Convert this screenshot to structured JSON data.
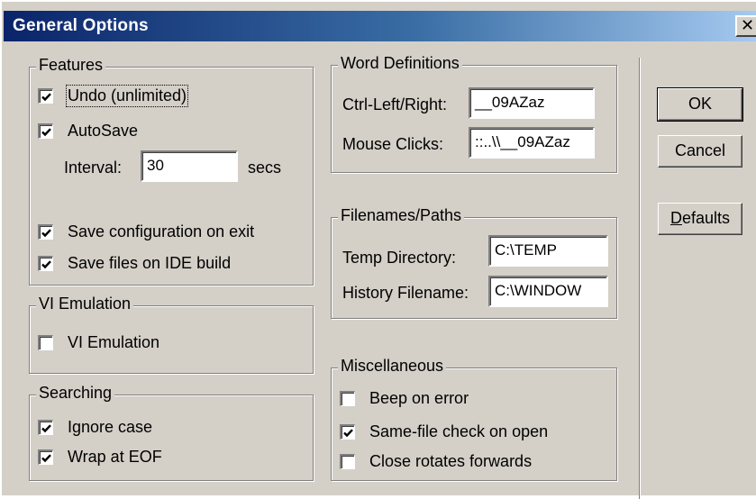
{
  "window": {
    "title": "General Options",
    "close_glyph": "✕"
  },
  "features": {
    "legend": "Features",
    "undo_label": "Undo (unlimited)",
    "undo_checked": true,
    "autosave_label": "AutoSave",
    "autosave_checked": true,
    "interval_label": "Interval:",
    "interval_value": "30",
    "interval_unit": "secs",
    "save_config_label": "Save configuration on exit",
    "save_config_checked": true,
    "save_files_label": "Save files on IDE build",
    "save_files_checked": true
  },
  "vi": {
    "legend": "VI Emulation",
    "option_label": "VI Emulation",
    "option_checked": false
  },
  "searching": {
    "legend": "Searching",
    "ignore_case_label": "Ignore case",
    "ignore_case_checked": true,
    "wrap_label": "Wrap at EOF",
    "wrap_checked": true
  },
  "word_definitions": {
    "legend": "Word Definitions",
    "ctrl_label": "Ctrl-Left/Right:",
    "ctrl_value": "__09AZaz",
    "mouse_label": "Mouse Clicks:",
    "mouse_value": "::..\\\\__09AZaz"
  },
  "paths": {
    "legend": "Filenames/Paths",
    "temp_label": "Temp Directory:",
    "temp_value": "C:\\TEMP",
    "history_label": "History Filename:",
    "history_value": "C:\\WINDOW"
  },
  "misc": {
    "legend": "Miscellaneous",
    "beep_label": "Beep on error",
    "beep_checked": false,
    "samefile_label": "Same-file check on open",
    "samefile_checked": true,
    "close_rot_label": "Close rotates forwards",
    "close_rot_checked": false
  },
  "buttons": {
    "ok": "OK",
    "cancel": "Cancel",
    "defaults_first": "D",
    "defaults_rest": "efaults"
  }
}
